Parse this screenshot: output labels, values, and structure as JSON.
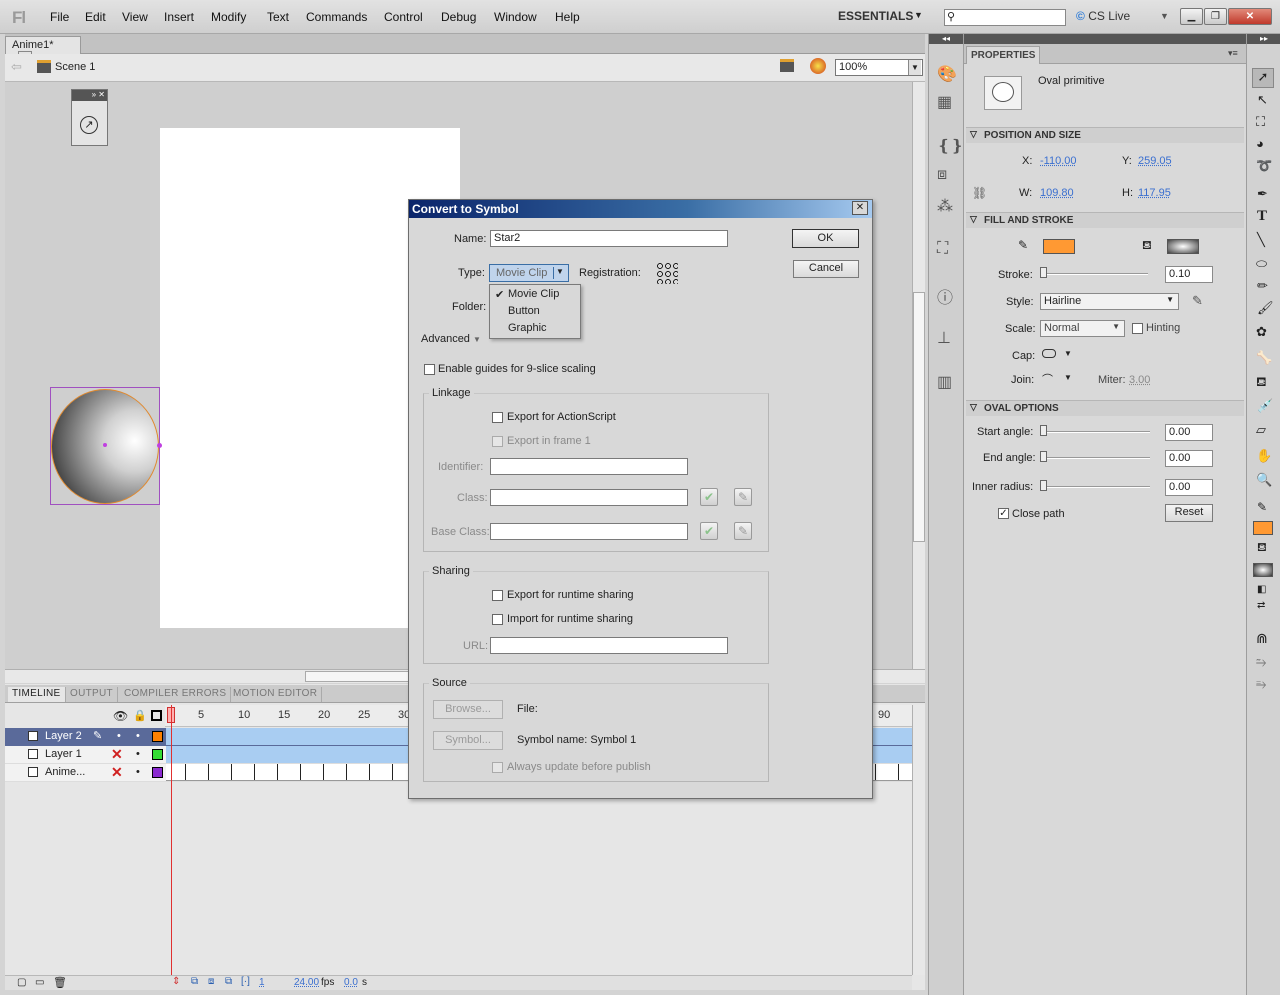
{
  "app": {
    "logo": "Fl",
    "workspace": "ESSENTIALS",
    "cslive": "CS Live"
  },
  "menu": [
    "File",
    "Edit",
    "View",
    "Insert",
    "Modify",
    "Text",
    "Commands",
    "Control",
    "Debug",
    "Window",
    "Help"
  ],
  "document": {
    "tab": "Anime1*",
    "scene": "Scene 1",
    "zoom": "100%"
  },
  "timeline": {
    "tabs": [
      "TIMELINE",
      "OUTPUT",
      "COMPILER ERRORS",
      "MOTION EDITOR"
    ],
    "ruler": [
      "1",
      "5",
      "10",
      "15",
      "20",
      "25",
      "30",
      "90"
    ],
    "layers": [
      {
        "name": "Layer 2",
        "color": "#ff8000",
        "selected": true
      },
      {
        "name": "Layer 1",
        "color": "#33dd33",
        "selected": false
      },
      {
        "name": "Anime...",
        "color": "#8a2ad0",
        "selected": false
      }
    ],
    "footer": {
      "frame": "1",
      "fps": "24.00",
      "fps_unit": "fps",
      "time": "0.0",
      "time_unit": "s"
    }
  },
  "properties": {
    "tab": "PROPERTIES",
    "object_type": "Oval primitive",
    "position_size": {
      "header": "POSITION AND SIZE",
      "x_label": "X:",
      "x": "-110.00",
      "y_label": "Y:",
      "y": "259.05",
      "w_label": "W:",
      "w": "109.80",
      "h_label": "H:",
      "h": "117.95"
    },
    "fill_stroke": {
      "header": "FILL AND STROKE",
      "stroke_label": "Stroke:",
      "stroke": "0.10",
      "style_label": "Style:",
      "style": "Hairline",
      "scale_label": "Scale:",
      "scale": "Normal",
      "hinting": "Hinting",
      "cap_label": "Cap:",
      "join_label": "Join:",
      "miter_label": "Miter:",
      "miter": "3.00",
      "stroke_color": "#ff9933"
    },
    "oval_options": {
      "header": "OVAL OPTIONS",
      "start_label": "Start angle:",
      "start": "0.00",
      "end_label": "End angle:",
      "end": "0.00",
      "inner_label": "Inner radius:",
      "inner": "0.00",
      "close_path": "Close path",
      "reset": "Reset"
    }
  },
  "dialog": {
    "title": "Convert to Symbol",
    "name_label": "Name:",
    "name": "Star2",
    "type_label": "Type:",
    "type": "Movie Clip",
    "registration_label": "Registration:",
    "folder_label": "Folder:",
    "advanced": "Advanced",
    "ok": "OK",
    "cancel": "Cancel",
    "type_options": [
      "Movie Clip",
      "Button",
      "Graphic"
    ],
    "nine_slice": "Enable guides for 9-slice scaling",
    "linkage": {
      "title": "Linkage",
      "export_as": "Export for ActionScript",
      "export_frame1": "Export in frame 1",
      "identifier_label": "Identifier:",
      "class_label": "Class:",
      "base_class_label": "Base Class:"
    },
    "sharing": {
      "title": "Sharing",
      "export_runtime": "Export for runtime sharing",
      "import_runtime": "Import for runtime sharing",
      "url_label": "URL:"
    },
    "source": {
      "title": "Source",
      "browse": "Browse...",
      "file_label": "File:",
      "symbol": "Symbol...",
      "symbol_name": "Symbol name: Symbol 1",
      "always_update": "Always update before publish"
    }
  }
}
